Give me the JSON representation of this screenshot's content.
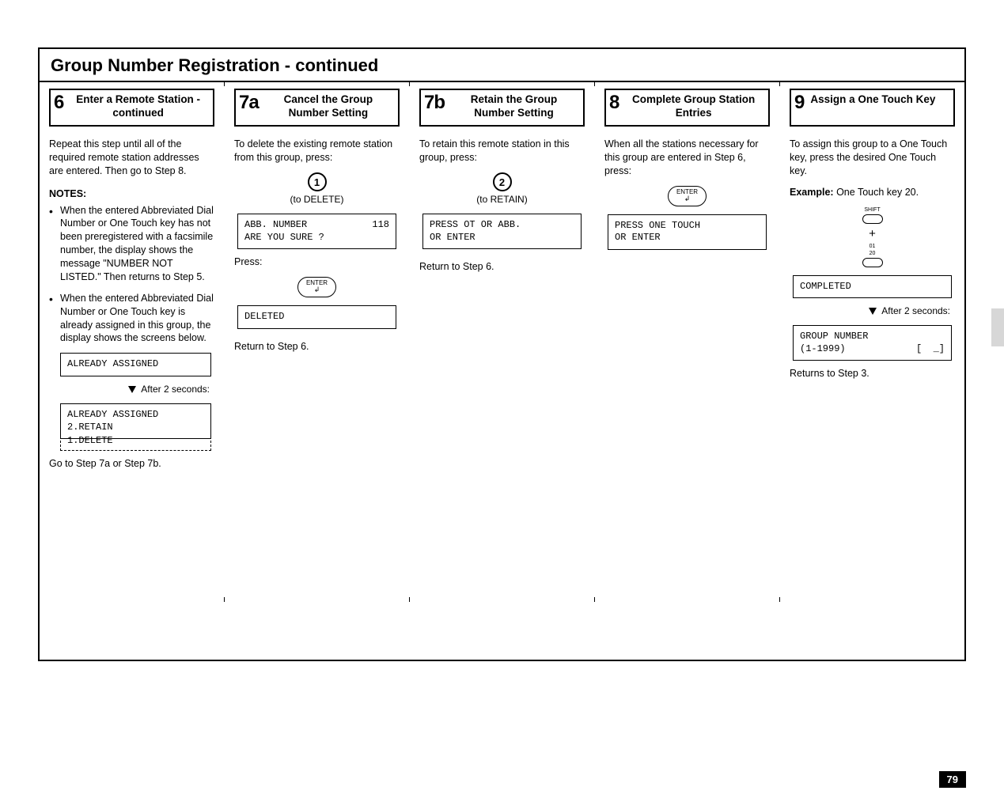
{
  "page": {
    "title": "Group Number Registration - continued",
    "pageNumber": "79"
  },
  "col6": {
    "stepNum": "6",
    "stepTitle": "Enter a Remote Station - continued",
    "intro": "Repeat this step until all of the required remote station addresses are entered. Then go to Step 8.",
    "notesHead": "NOTES:",
    "note1": "When the entered Abbreviated Dial Number or One Touch key has not been preregistered with a facsimile number, the display shows the message \"NUMBER NOT LISTED.\" Then returns to Step 5.",
    "note2": "When the entered Abbreviated Dial Number or One Touch key is already assigned in this group, the display shows the screens below.",
    "lcd1": "ALREADY ASSIGNED",
    "after1": "After 2 seconds:",
    "lcd2": "ALREADY ASSIGNED\n2.RETAIN",
    "lcd2ext": "1.DELETE",
    "outro": "Go to Step 7a or Step 7b."
  },
  "col7a": {
    "stepNum": "7a",
    "stepTitle": "Cancel the Group Number Setting",
    "intro": "To delete the existing remote station from this group, press:",
    "key1Label": "1",
    "key1Caption": "(to DELETE)",
    "lcd1_left": "ABB. NUMBER",
    "lcd1_right": "118",
    "lcd1_line2": "ARE YOU SURE ?",
    "press": "Press:",
    "enterLabel": "ENTER",
    "lcd2": "DELETED",
    "outro": "Return to Step 6."
  },
  "col7b": {
    "stepNum": "7b",
    "stepTitle": "Retain the Group Number Setting",
    "intro": "To retain this remote station in this group, press:",
    "key2Label": "2",
    "key2Caption": "(to RETAIN)",
    "lcd": "PRESS OT OR ABB.\nOR ENTER",
    "outro": "Return to Step 6."
  },
  "col8": {
    "stepNum": "8",
    "stepTitle": "Complete Group Station Entries",
    "intro": "When all the stations necessary for this group are entered in Step 6,  press:",
    "enterLabel": "ENTER",
    "lcd": "PRESS ONE TOUCH\nOR ENTER"
  },
  "col9": {
    "stepNum": "9",
    "stepTitle": "Assign a One Touch Key",
    "intro": "To assign this group to a One Touch key, press the desired One Touch key.",
    "exampleLabel": "Example:",
    "exampleText": "  One Touch key 20.",
    "shiftLabel": "SHIFT",
    "plus": "+",
    "tiny1": "01",
    "tiny2": "20",
    "lcd1": "COMPLETED",
    "after": "After 2 seconds:",
    "lcd2_l1": "GROUP NUMBER",
    "lcd2_l2_left": "(1-1999)",
    "lcd2_l2_right": "[  _]",
    "outro": "Returns to Step 3."
  }
}
